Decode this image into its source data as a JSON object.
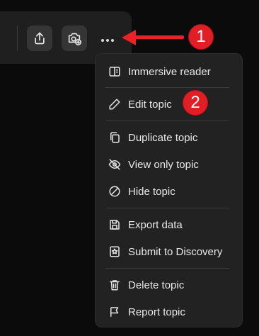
{
  "toolbar": {
    "share_icon": "share-icon",
    "camera_icon": "camera-add-icon",
    "more_icon": "more-dots-icon"
  },
  "annotations": {
    "badge1": "1",
    "badge2": "2",
    "accent": "#e01e26"
  },
  "menu": {
    "items": [
      {
        "label": "Immersive reader",
        "icon": "book-reader-icon"
      },
      {
        "label": "Edit topic",
        "icon": "pencil-icon"
      },
      {
        "label": "Duplicate topic",
        "icon": "duplicate-icon"
      },
      {
        "label": "View only topic",
        "icon": "eye-off-icon"
      },
      {
        "label": "Hide topic",
        "icon": "hide-circle-icon"
      },
      {
        "label": "Export data",
        "icon": "save-icon"
      },
      {
        "label": "Submit to Discovery",
        "icon": "star-frame-icon"
      },
      {
        "label": "Delete topic",
        "icon": "trash-icon"
      },
      {
        "label": "Report topic",
        "icon": "flag-icon"
      }
    ]
  }
}
